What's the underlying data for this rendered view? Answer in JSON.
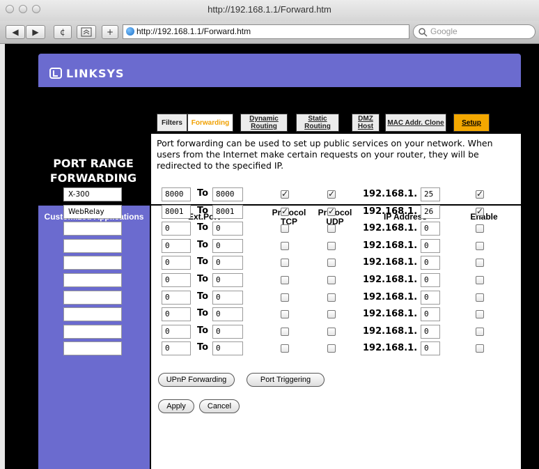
{
  "window": {
    "title": "http://192.168.1.1/Forward.htm"
  },
  "toolbar": {
    "back": "◀",
    "forward": "▶",
    "reload": "¢",
    "add": "+",
    "url": "http://192.168.1.1/Forward.htm",
    "search_placeholder": "Google"
  },
  "brand": {
    "logo": "LINKSYS"
  },
  "tabs": [
    {
      "label": "Filters"
    },
    {
      "label": "Forwarding"
    },
    {
      "label": "Dynamic Routing"
    },
    {
      "label": "Static Routing"
    },
    {
      "label": "DMZ Host"
    },
    {
      "label": "MAC Addr. Clone"
    },
    {
      "label": "Setup"
    }
  ],
  "page": {
    "title": "PORT RANGE FORWARDING",
    "description": "Port forwarding can be used to set up public services on your network. When users from the Internet make certain requests on your router, they will be redirected to the specified IP."
  },
  "table": {
    "headers": {
      "apps": "Customized Applications",
      "ext_port": "Ext.Port",
      "tcp": "Protocol TCP",
      "udp": "Protocol UDP",
      "ip": "IP Address",
      "enable": "Enable"
    },
    "to_label": "To",
    "ip_prefix": "192.168.1.",
    "rows": [
      {
        "app": "X-300",
        "start": "8000",
        "end": "8000",
        "tcp": true,
        "udp": true,
        "ip": "25",
        "enable": true
      },
      {
        "app": "WebRelay",
        "start": "8001",
        "end": "8001",
        "tcp": true,
        "udp": true,
        "ip": "26",
        "enable": true
      },
      {
        "app": "",
        "start": "0",
        "end": "0",
        "tcp": false,
        "udp": false,
        "ip": "0",
        "enable": false
      },
      {
        "app": "",
        "start": "0",
        "end": "0",
        "tcp": false,
        "udp": false,
        "ip": "0",
        "enable": false
      },
      {
        "app": "",
        "start": "0",
        "end": "0",
        "tcp": false,
        "udp": false,
        "ip": "0",
        "enable": false
      },
      {
        "app": "",
        "start": "0",
        "end": "0",
        "tcp": false,
        "udp": false,
        "ip": "0",
        "enable": false
      },
      {
        "app": "",
        "start": "0",
        "end": "0",
        "tcp": false,
        "udp": false,
        "ip": "0",
        "enable": false
      },
      {
        "app": "",
        "start": "0",
        "end": "0",
        "tcp": false,
        "udp": false,
        "ip": "0",
        "enable": false
      },
      {
        "app": "",
        "start": "0",
        "end": "0",
        "tcp": false,
        "udp": false,
        "ip": "0",
        "enable": false
      },
      {
        "app": "",
        "start": "0",
        "end": "0",
        "tcp": false,
        "udp": false,
        "ip": "0",
        "enable": false
      }
    ]
  },
  "buttons": {
    "upnp": "UPnP Forwarding",
    "port_triggering": "Port Triggering",
    "apply": "Apply",
    "cancel": "Cancel"
  }
}
